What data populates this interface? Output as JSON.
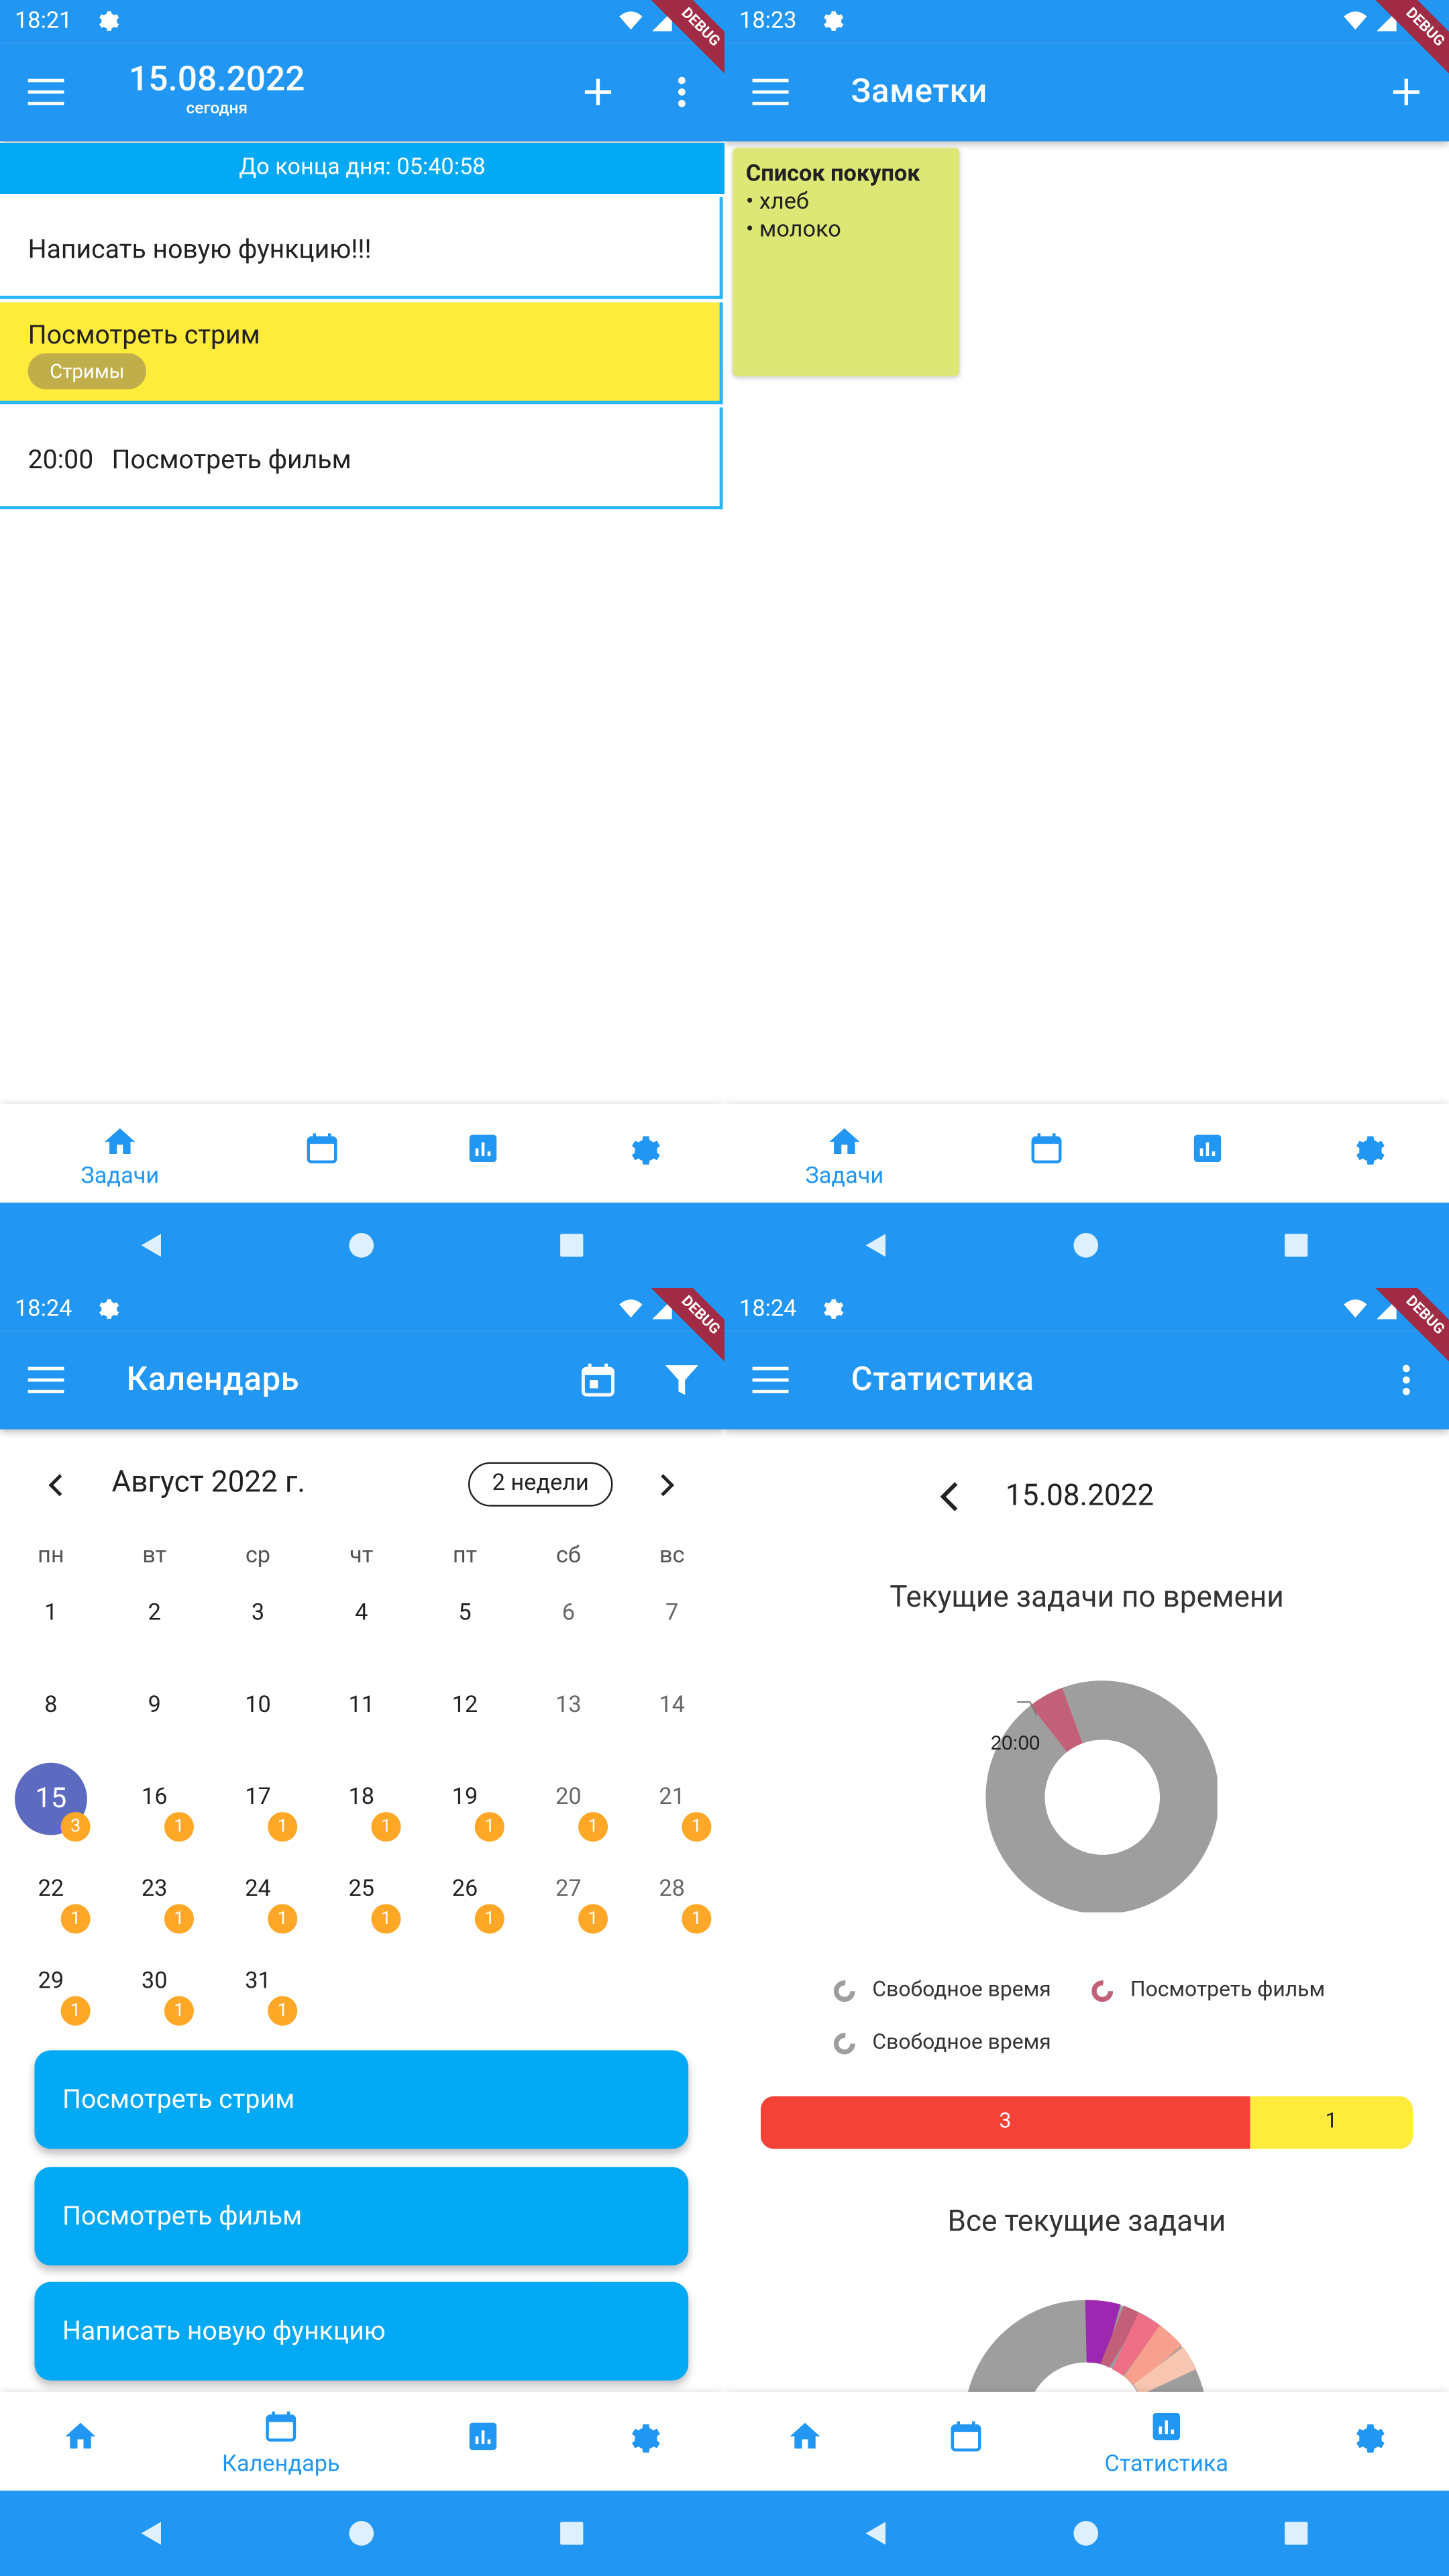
{
  "panels": {
    "tasks": {
      "status_time": "18:21",
      "date": "15.08.2022",
      "date_sub": "сегодня",
      "countdown": "До конца дня: 05:40:58",
      "tasks": [
        {
          "time": "",
          "label": "Написать новую функцию!!!"
        },
        {
          "time": "",
          "label": "Посмотреть стрим",
          "tag": "Стримы"
        },
        {
          "time": "20:00",
          "label": "Посмотреть фильм"
        }
      ],
      "nav_label": "Задачи"
    },
    "notes": {
      "status_time": "18:23",
      "title": "Заметки",
      "note_title": "Список покупок",
      "note_lines": [
        "• хлеб",
        "• молоко"
      ],
      "nav_label": "Задачи"
    },
    "calendar": {
      "status_time": "18:24",
      "title": "Календарь",
      "month": "Август 2022 г.",
      "range_button": "2 недели",
      "weekdays": [
        "пн",
        "вт",
        "ср",
        "чт",
        "пт",
        "сб",
        "вс"
      ],
      "days": [
        "1",
        "2",
        "3",
        "4",
        "5",
        "6",
        "7",
        "8",
        "9",
        "10",
        "11",
        "12",
        "13",
        "14",
        "15",
        "16",
        "17",
        "18",
        "19",
        "20",
        "21",
        "22",
        "23",
        "24",
        "25",
        "26",
        "27",
        "28",
        "29",
        "30",
        "31"
      ],
      "badges": {
        "15": "3",
        "16": "1",
        "17": "1",
        "18": "1",
        "19": "1",
        "20": "1",
        "21": "1",
        "22": "1",
        "23": "1",
        "24": "1",
        "25": "1",
        "26": "1",
        "27": "1",
        "28": "1",
        "29": "1",
        "30": "1",
        "31": "1"
      },
      "selected_day": "15",
      "events": [
        "Посмотреть стрим",
        "Посмотреть фильм",
        "Написать новую функцию"
      ],
      "nav_label": "Календарь"
    },
    "stats": {
      "status_time": "18:24",
      "title": "Статистика",
      "date": "15.08.2022",
      "chart1_title": "Текущие задачи по времени",
      "chart2_title": "Все текущие задачи",
      "donut_label": "20:00",
      "legend": [
        "Свободное время",
        "Посмотреть фильм",
        "Свободное время"
      ],
      "bar_values": {
        "done": "3",
        "rest": "1"
      },
      "nav_label": "Статистика"
    }
  },
  "debug_ribbon": "DEBUG",
  "colors": {
    "primary": "#2196f3",
    "task_border": "#29b6f6",
    "stream_bg": "#ffeb3b",
    "note_bg": "#dce775",
    "event_bg": "#03a9f4",
    "badge": "#ffa726",
    "selected": "#5c6bc0",
    "bar_red": "#f44336",
    "bar_yellow": "#ffeb3b",
    "donut_gray": "#9e9e9e",
    "donut_pink": "#c2607a"
  },
  "chart_data": [
    {
      "type": "pie",
      "title": "Текущие задачи по времени",
      "labels": [
        "Свободное время",
        "Посмотреть фильм",
        "Свободное время"
      ],
      "values": [
        0.95,
        0.05,
        0
      ]
    },
    {
      "type": "bar",
      "title": "",
      "categories": [
        "3",
        "1"
      ],
      "values": [
        3,
        1
      ]
    }
  ]
}
